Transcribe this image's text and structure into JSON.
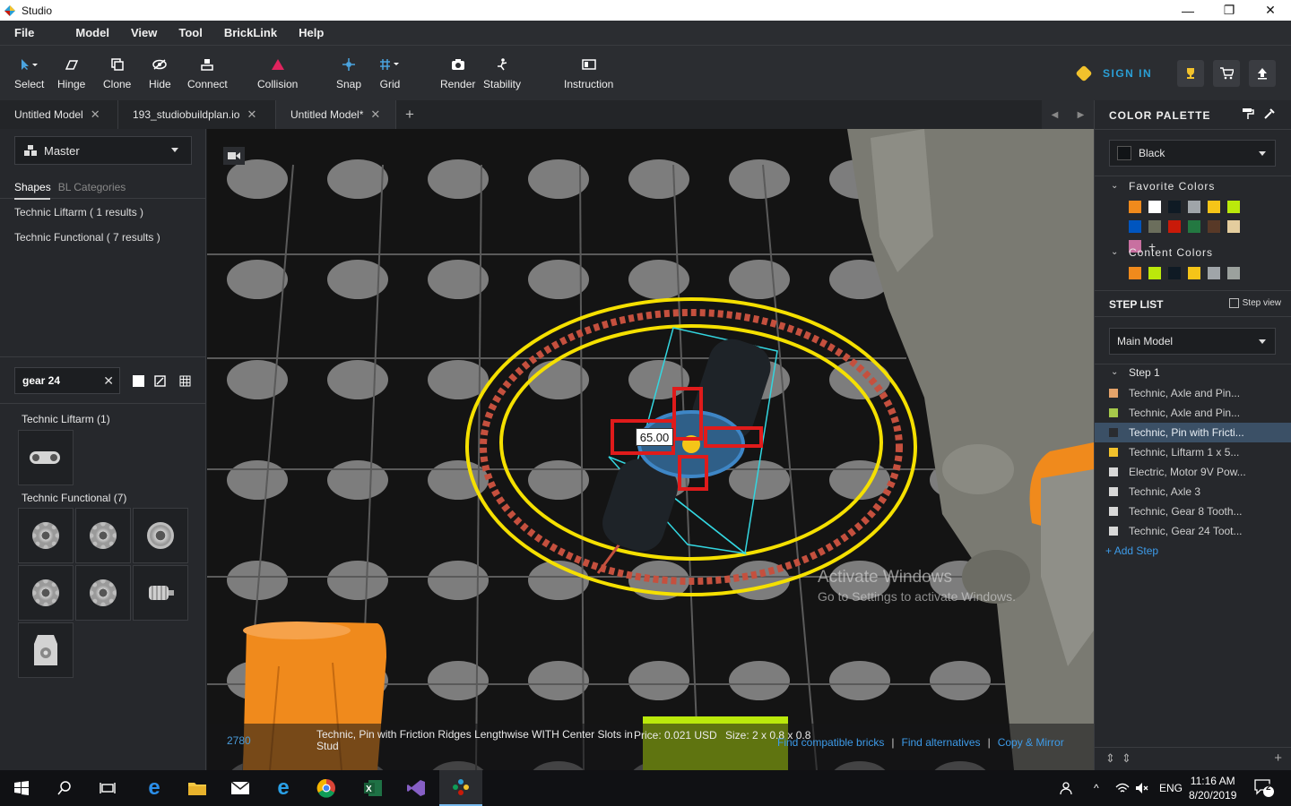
{
  "window": {
    "title": "Studio",
    "controls": [
      "—",
      "❐",
      "✕"
    ]
  },
  "menu": [
    "File",
    "Model",
    "View",
    "Tool",
    "BrickLink",
    "Help"
  ],
  "toolbar": {
    "tools": [
      {
        "label": "Select",
        "icon": "cursor-icon"
      },
      {
        "label": "Hinge",
        "icon": "hinge-icon"
      },
      {
        "label": "Clone",
        "icon": "clone-icon"
      },
      {
        "label": "Hide",
        "icon": "hide-icon"
      },
      {
        "label": "Connect",
        "icon": "connect-icon"
      },
      {
        "label": "Collision",
        "icon": "collision-icon"
      },
      {
        "label": "Snap",
        "icon": "snap-icon"
      },
      {
        "label": "Grid",
        "icon": "grid-icon"
      },
      {
        "label": "Render",
        "icon": "camera-icon"
      },
      {
        "label": "Stability",
        "icon": "stability-icon"
      },
      {
        "label": "Instruction",
        "icon": "instruction-icon"
      }
    ],
    "sign_in": "SIGN IN"
  },
  "tabs": [
    {
      "label": "Untitled Model"
    },
    {
      "label": "193_studiobuildplan.io"
    },
    {
      "label": "Untitled Model*"
    }
  ],
  "left": {
    "master": "Master",
    "tab_shapes": "Shapes",
    "tab_bl": "BL Categories",
    "results": [
      "Technic Liftarm ( 1 results )",
      "Technic Functional ( 7 results )"
    ],
    "search_value": "gear 24",
    "section_liftarm": "Technic Liftarm (1)",
    "section_functional": "Technic Functional (7)"
  },
  "viewport": {
    "angle_value": "65.00",
    "status": {
      "id": "2780",
      "name": "Technic, Pin with Friction Ridges Lengthwise WITH Center Slots in Stud",
      "price": "Price: 0.021 USD",
      "size": "Size: 2 x 0.8 x 0.8",
      "links": [
        "Find compatible bricks",
        "Find alternatives",
        "Copy & Mirror"
      ]
    },
    "activate_title": "Activate Windows",
    "activate_sub": "Go to Settings to activate Windows."
  },
  "right": {
    "palette_title": "COLOR PALETTE",
    "selected_color": "Black",
    "favorite_title": "Favorite Colors",
    "favorite_colors": [
      "#f08a1c",
      "#ffffff",
      "#0f1a24",
      "#a0a5a9",
      "#f5c518",
      "#bbe90b",
      "#0055bf",
      "#6b6e5c",
      "#c91a09",
      "#237841",
      "#583927",
      "#e4cd9e",
      "#c870a0"
    ],
    "content_title": "Content Colors",
    "content_colors": [
      "#f08a1c",
      "#bbe90b",
      "#0f1a24",
      "#f5c518",
      "#a0a5a9",
      "#9ba19d"
    ],
    "steplist_title": "STEP LIST",
    "step_view": "Step view",
    "main_model": "Main Model",
    "step1": "Step 1",
    "steps": [
      {
        "label": "Technic, Axle and Pin...",
        "color": "#e4a36a"
      },
      {
        "label": "Technic, Axle and Pin...",
        "color": "#a6c94b"
      },
      {
        "label": "Technic, Pin with Fricti...",
        "color": "#2a2c30"
      },
      {
        "label": "Technic, Liftarm 1 x 5...",
        "color": "#f2c22c"
      },
      {
        "label": "Electric, Motor 9V Pow...",
        "color": "#d8d8d8"
      },
      {
        "label": "Technic, Axle 3",
        "color": "#d8d8d8"
      },
      {
        "label": "Technic, Gear 8 Tooth...",
        "color": "#d8d8d8"
      },
      {
        "label": "Technic, Gear 24 Toot...",
        "color": "#d8d8d8"
      }
    ],
    "add_step": "Add Step"
  },
  "taskbar": {
    "lang": "ENG",
    "time": "11:16 AM",
    "date": "8/20/2019",
    "notif": "2"
  }
}
